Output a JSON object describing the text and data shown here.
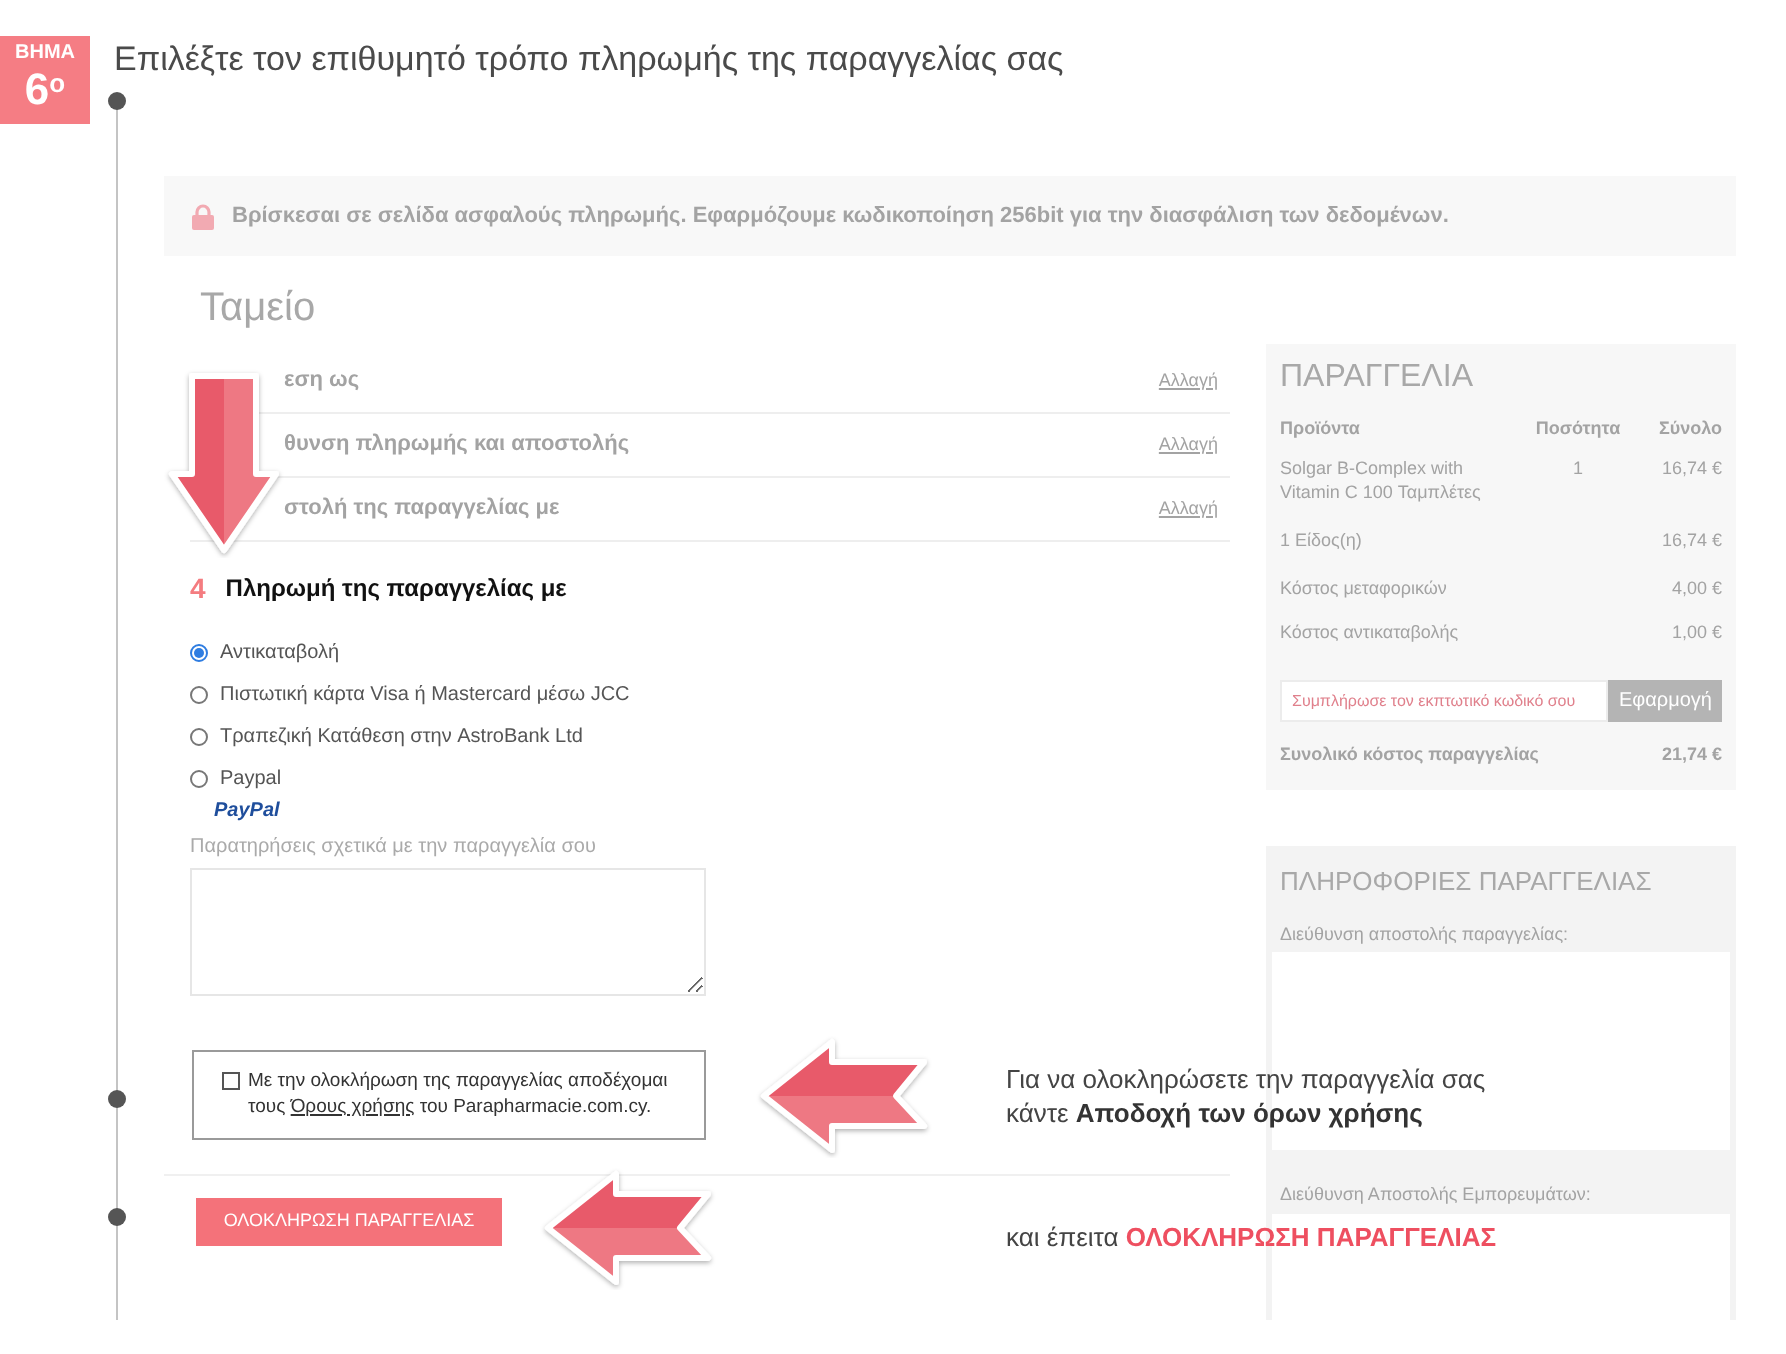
{
  "step": {
    "label": "ΒΗΜΑ",
    "number": "6$^{ο}$",
    "title": "Επιλέξτε τον επιθυμητό τρόπο πληρωμής της παραγγελίας σας"
  },
  "notice": "Βρίσκεσαι σε σελίδα ασφαλούς πληρωμής. Εφαρμόζουμε κωδικοποίηση 256bit για την διασφάλιση των δεδομένων.",
  "checkout": {
    "title": "Ταμείο",
    "steps": [
      {
        "label": "εση ως",
        "action": "Αλλαγή"
      },
      {
        "label": "θυνση πληρωμής και αποστολής",
        "action": "Αλλαγή"
      },
      {
        "label": "στολή της παραγγελίας με",
        "action": "Αλλαγή"
      }
    ],
    "payment": {
      "number": "4",
      "title": "Πληρωμή της παραγγελίας με",
      "options": [
        {
          "label": "Αντικαταβολή",
          "selected": true
        },
        {
          "label": "Πιστωτική κάρτα Visa ή Mastercard μέσω JCC",
          "selected": false
        },
        {
          "label": "Τραπεζική Κατάθεση στην AstroBank Ltd",
          "selected": false
        },
        {
          "label": "Paypal",
          "selected": false
        }
      ],
      "logo": "PayPal"
    },
    "notes": {
      "label": "Παρατηρήσεις σχετικά με την παραγγελία σου"
    },
    "terms": {
      "checked": false,
      "text_before": "Με την ολοκλήρωση της παραγγελίας αποδέχομαι τους",
      "link": "Όρους χρήσης",
      "text_after": "του Parapharmacie.com.cy."
    },
    "submit": "ΟΛΟΚΛΗΡΩΣΗ ΠΑΡΑΓΓΕΛΙΑΣ"
  },
  "order": {
    "title": "ΠΑΡΑΓΓΕΛΙΑ",
    "columns": [
      "Προϊόντα",
      "Ποσότητα",
      "Σύνολο"
    ],
    "items": [
      {
        "name": "Solgar B-Complex with Vitamin C 100 Ταμπλέτες",
        "quantity": "1",
        "total": "16,74 €"
      }
    ],
    "summary": [
      {
        "label": "1 Είδος(η)",
        "value": "16,74 €"
      },
      {
        "label": "Κόστος μεταφορικών",
        "value": "4,00 €"
      },
      {
        "label": "Κόστος αντικαταβολής",
        "value": "1,00 €"
      }
    ],
    "coupon": {
      "placeholder": "Συμπλήρωσε τον εκπτωτικό κωδικό σου",
      "button": "Εφαρμογή"
    },
    "total": {
      "label": "Συνολικό κόστος παραγγελίας",
      "value": "21,74 €"
    }
  },
  "order_info": {
    "title": "ΠΛΗΡΟΦΟΡΙΕΣ ΠΑΡΑΓΓΕΛΙΑΣ",
    "fields": [
      "Διεύθυνση αποστολής παραγγελίας:",
      "Διεύθυνση Αποστολής Εμπορευμάτων:"
    ]
  },
  "callouts": [
    {
      "kind": "plain",
      "lines": [
        "Για να ολοκληρώσετε την παραγγελία σας",
        "κάντε **Αποδοχή των όρων χρήσης**"
      ]
    },
    {
      "kind": "accent",
      "lines": [
        "και έπειτα **ΟΛΟΚΛΗΡΩΣΗ ΠΑΡΑΓΓΕΛΙΑΣ**"
      ]
    }
  ]
}
